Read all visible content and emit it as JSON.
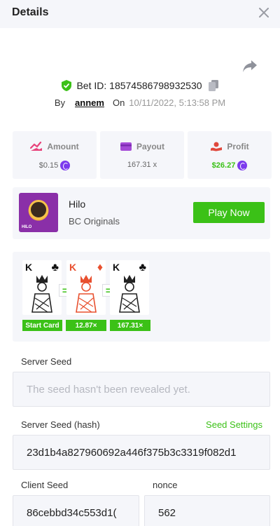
{
  "header": {
    "title": "Details"
  },
  "bet": {
    "id_text": "Bet ID: 18574586798932530",
    "by_label": "By",
    "user": "annem",
    "on_label": "On",
    "date": "10/11/2022, 5:13:58 PM"
  },
  "stats": {
    "amount": {
      "label": "Amount",
      "value": "$0.15",
      "value_color": "#666666"
    },
    "payout": {
      "label": "Payout",
      "value": "167.31 x",
      "value_color": "#666666"
    },
    "profit": {
      "label": "Profit",
      "value": "$26.27",
      "value_color": "#3bc117"
    }
  },
  "game": {
    "name": "Hilo",
    "provider": "BC Originals",
    "thumb_label": "HILO",
    "play_label": "Play Now"
  },
  "cards": [
    {
      "rank": "K",
      "suit": "♣",
      "suit_color": "#111111",
      "tag": "Start Card"
    },
    {
      "rank": "K",
      "suit": "♦",
      "suit_color": "#e8502f",
      "tag": "12.87×"
    },
    {
      "rank": "K",
      "suit": "♣",
      "suit_color": "#111111",
      "tag": "167.31×"
    }
  ],
  "equals": [
    "=",
    "="
  ],
  "seeds": {
    "server_label": "Server Seed",
    "server_placeholder": "The seed hasn't been revealed yet.",
    "server_hash_label": "Server Seed (hash)",
    "seed_settings": "Seed Settings",
    "server_hash": "23d1b4a827960692a446f375b3c3319f082d1",
    "client_label": "Client Seed",
    "client_seed": "86cebbd34c553d1(",
    "nonce_label": "nonce",
    "nonce": "562"
  },
  "colors": {
    "accent": "#3bc117",
    "panel": "#f5f6fa",
    "coin": "#7c3aed"
  },
  "icons": {
    "close": "close-icon",
    "share": "share-icon",
    "shield": "shield-check-icon",
    "copy": "copy-icon",
    "amount": "amount-icon",
    "payout": "wallet-icon",
    "profit": "profit-icon"
  }
}
